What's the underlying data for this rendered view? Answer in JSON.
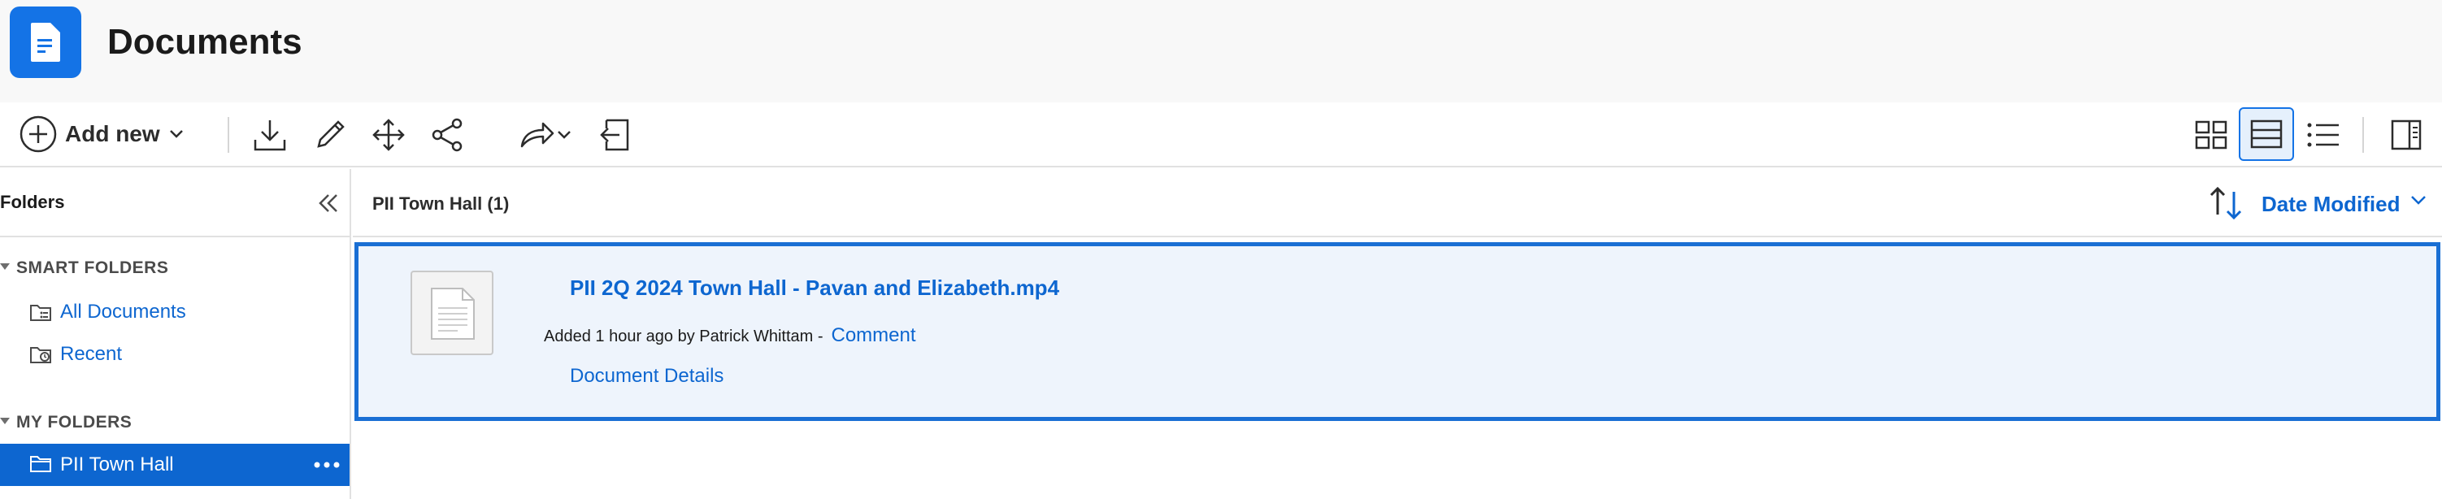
{
  "app": {
    "title": "Documents"
  },
  "toolbar": {
    "add_new_label": "Add new",
    "icons": [
      "download-icon",
      "edit-icon",
      "move-icon",
      "share-icon",
      "forward-icon",
      "chevron-down-icon",
      "export-icon",
      "grid-view-icon",
      "card-view-icon",
      "list-view-icon",
      "panel-toggle-icon"
    ]
  },
  "sidebar": {
    "title": "Folders",
    "smart_folders_label": "SMART FOLDERS",
    "smart_items": [
      {
        "label": "All Documents"
      },
      {
        "label": "Recent"
      }
    ],
    "my_folders_label": "MY FOLDERS",
    "my_items": [
      {
        "label": "PII Town Hall",
        "selected": true
      }
    ]
  },
  "main": {
    "breadcrumb": "PII Town Hall (1)",
    "sort_label": "Date Modified",
    "documents": [
      {
        "title": "PII 2Q 2024 Town Hall - Pavan and Elizabeth.mp4",
        "meta": "Added 1 hour ago by Patrick Whittam -",
        "comment_label": "Comment",
        "details_label": "Document Details"
      }
    ]
  },
  "colors": {
    "accent": "#0d66d0",
    "logo": "#1473e6",
    "selected_bg": "#0d66d0",
    "card_bg": "#eef4fc"
  }
}
